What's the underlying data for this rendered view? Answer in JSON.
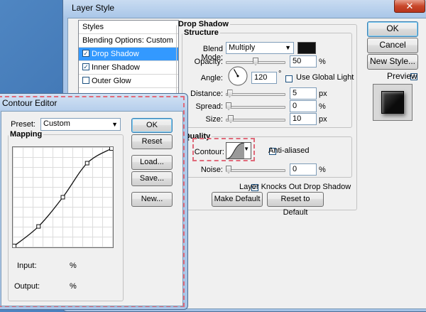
{
  "layer_style": {
    "title": "Layer Style",
    "close_glyph": "✕",
    "styles_header": "Styles",
    "style_items": [
      {
        "label": "Blending Options: Custom",
        "checkbox": false,
        "checked": false,
        "selected": false
      },
      {
        "label": "Drop Shadow",
        "checkbox": true,
        "checked": true,
        "selected": true
      },
      {
        "label": "Inner Shadow",
        "checkbox": true,
        "checked": true,
        "selected": false
      },
      {
        "label": "Outer Glow",
        "checkbox": true,
        "checked": false,
        "selected": false
      }
    ],
    "drop_shadow": {
      "group_label": "Drop Shadow",
      "structure_label": "Structure",
      "blend_mode_label": "Blend Mode:",
      "blend_mode_value": "Multiply",
      "shadow_color": "#111111",
      "opacity_label": "Opacity:",
      "opacity_value": "50",
      "opacity_fraction": 0.5,
      "angle_label": "Angle:",
      "angle_value": "120",
      "angle_unit": "°",
      "use_global_light_label": "Use Global Light",
      "use_global_light_checked": false,
      "distance_label": "Distance:",
      "distance_value": "5",
      "distance_fraction": 0.02,
      "spread_label": "Spread:",
      "spread_value": "0",
      "spread_fraction": 0.0,
      "size_label": "Size:",
      "size_value": "10",
      "size_fraction": 0.04,
      "quality_label": "Quality",
      "contour_label": "Contour:",
      "anti_aliased_label": "Anti-aliased",
      "anti_aliased_checked": false,
      "noise_label": "Noise:",
      "noise_value": "0",
      "noise_fraction": 0.0,
      "knockout_label": "Layer Knocks Out Drop Shadow",
      "knockout_checked": true,
      "make_default_label": "Make Default",
      "reset_default_label": "Reset to Default",
      "px": "px",
      "percent": "%"
    },
    "buttons": {
      "ok": "OK",
      "cancel": "Cancel",
      "new_style": "New Style...",
      "preview_label": "Preview",
      "preview_checked": true
    }
  },
  "contour_editor": {
    "title": "Contour Editor",
    "preset_label": "Preset:",
    "preset_value": "Custom",
    "mapping_label": "Mapping",
    "input_label": "Input:",
    "input_unit": "%",
    "output_label": "Output:",
    "output_unit": "%",
    "buttons": {
      "ok": "OK",
      "reset": "Reset",
      "load": "Load...",
      "save": "Save...",
      "new": "New..."
    },
    "curve_points": [
      [
        0,
        0
      ],
      [
        25,
        20
      ],
      [
        50,
        50
      ],
      [
        75,
        85
      ],
      [
        100,
        100
      ]
    ]
  },
  "colors": {
    "selection": "#3399ff",
    "highlight_dash": "#e06a7a"
  }
}
